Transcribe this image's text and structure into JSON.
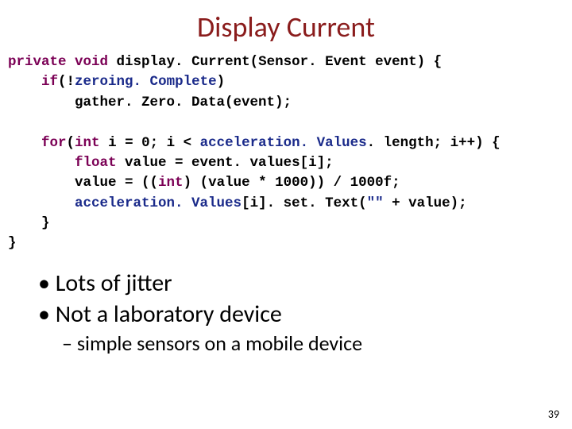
{
  "title": "Display Current",
  "code": {
    "l1_kw1": "private",
    "l1_kw2": "void",
    "l1_rest": " display. Current(Sensor. Event event) {",
    "l2_indent": "    ",
    "l2_kw": "if",
    "l2_paren": "(!",
    "l2_fld": "zeroing. Complete",
    "l2_close": ")",
    "l3": "        gather. Zero. Data(event);",
    "l4_indent": "    ",
    "l4_kw1": "for",
    "l4_p1": "(",
    "l4_kw2": "int",
    "l4_p2": " i = 0; i < ",
    "l4_fld": "acceleration. Values",
    "l4_p3": ". length; i++) {",
    "l5_indent": "        ",
    "l5_kw": "float",
    "l5_rest": " value = event. values[i];",
    "l6_indent": "        ",
    "l6_a": "value = ((",
    "l6_kw": "int",
    "l6_b": ") (value * 1000)) / 1000f;",
    "l7_indent": "        ",
    "l7_fld": "acceleration. Values",
    "l7_a": "[i]. set. Text(",
    "l7_str": "\"\"",
    "l7_b": " + value);",
    "l8": "    }",
    "l9": "}"
  },
  "bullets": {
    "b1a": "Lots of jitter",
    "b1b": "Not a laboratory device",
    "b2a": "simple sensors on a mobile device"
  },
  "pagenum": "39"
}
